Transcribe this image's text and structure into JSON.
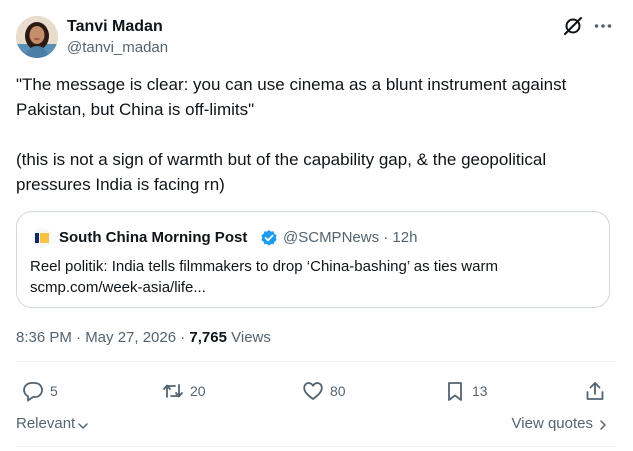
{
  "author": {
    "name": "Tanvi Madan",
    "handle": "@tanvi_madan"
  },
  "tweet": {
    "paragraph_1": "\"The message is clear: you can use cinema as a blunt instrument against Pakistan, but China is off-limits\"",
    "paragraph_2": "(this is not a sign of warmth but of the capability gap, & the geopolitical pressures India is facing rn)"
  },
  "quote": {
    "source_name": "South China Morning Post",
    "source_handle_time": "@SCMPNews · 12h",
    "headline": "Reel politik: India tells filmmakers to drop ‘China-bashing’ as ties warm",
    "link": "scmp.com/week-asia/life..."
  },
  "meta": {
    "time_date": "8:36 PM · May 27, 2026 · ",
    "views_count": "7,765",
    "views_label": " Views"
  },
  "actions": {
    "replies": "5",
    "reposts": "20",
    "likes": "80",
    "bookmarks": "13"
  },
  "footer": {
    "sort_label": "Relevant",
    "view_quotes_label": "View quotes"
  },
  "icons": {
    "grok": "grok-icon",
    "more": "more-icon",
    "reply": "reply-icon",
    "repost": "repost-icon",
    "like": "like-icon",
    "bookmark": "bookmark-icon",
    "share": "share-icon",
    "verified": "verified-badge-icon"
  },
  "colors": {
    "text_primary": "#0f1419",
    "text_secondary": "#536471",
    "border": "#cfd9de",
    "verified": "#1d9bf0"
  }
}
